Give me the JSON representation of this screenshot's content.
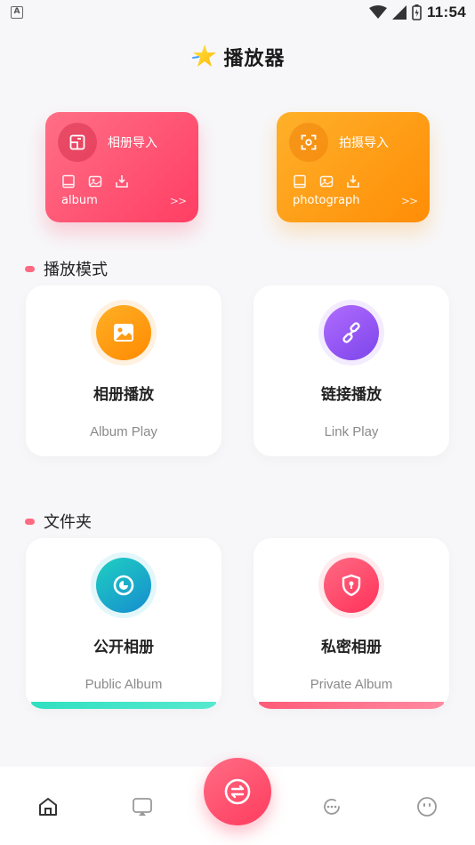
{
  "status_bar": {
    "left_icon": "A",
    "time": "11:54",
    "icons": [
      "wifi-icon",
      "signal-icon",
      "battery-icon"
    ]
  },
  "header": {
    "title": "播放器",
    "logo": "star-icon"
  },
  "import_cards": [
    {
      "label": "相册导入",
      "subtitle": "album",
      "arrow": ">>",
      "icon": "album-import-icon",
      "color_from": "#ff6f86",
      "color_to": "#ff3e64"
    },
    {
      "label": "拍摄导入",
      "subtitle": "photograph",
      "arrow": ">>",
      "icon": "camera-scan-icon",
      "color_from": "#ffb02a",
      "color_to": "#ff8d06"
    }
  ],
  "sections": {
    "play_mode": {
      "title": "播放模式",
      "cards": [
        {
          "name": "相册播放",
          "en": "Album Play",
          "icon": "image-icon",
          "color": "#ff9a12"
        },
        {
          "name": "链接播放",
          "en": "Link Play",
          "icon": "link-icon",
          "color": "#9b5cf6"
        }
      ]
    },
    "folders": {
      "title": "文件夹",
      "cards": [
        {
          "name": "公开相册",
          "en": "Public Album",
          "icon": "eye-icon",
          "color": "#18b9c9",
          "bar_color": "#3fe0c4"
        },
        {
          "name": "私密相册",
          "en": "Private Album",
          "icon": "shield-lock-icon",
          "color": "#ff4468",
          "bar_color": "#ff6f86"
        }
      ]
    }
  },
  "bottom_nav": {
    "items": [
      "home-icon",
      "screen-cast-icon",
      "exchange-icon",
      "chat-icon",
      "smile-icon"
    ],
    "active": "home-icon",
    "accent": "#ff4a6b"
  }
}
